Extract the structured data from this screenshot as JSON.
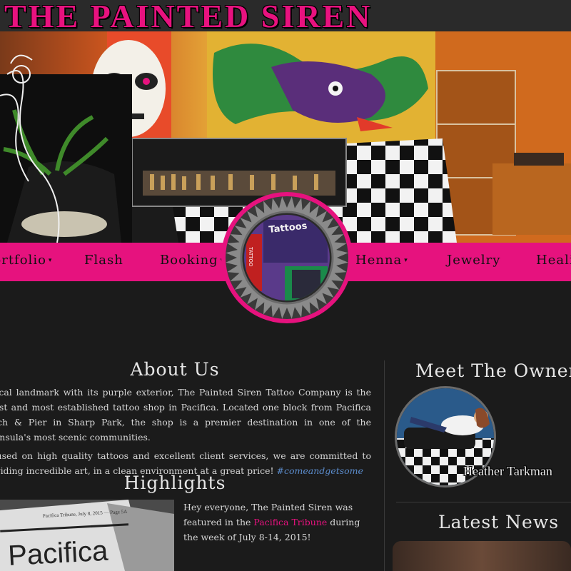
{
  "site": {
    "title": "The Painted Siren"
  },
  "nav": {
    "items": [
      {
        "label": "Portfolio",
        "has_dropdown": true
      },
      {
        "label": "Flash",
        "has_dropdown": false
      },
      {
        "label": "Booking",
        "has_dropdown": true
      },
      {
        "label": "Henna",
        "has_dropdown": true
      },
      {
        "label": "Jewelry",
        "has_dropdown": false
      },
      {
        "label": "Healing",
        "has_dropdown": false
      }
    ],
    "caret": "▾"
  },
  "logo": {
    "sign_text_1": "Tattoos",
    "sign_text_2": "TATTOO"
  },
  "about": {
    "heading": "About Us",
    "paragraph_1": "A local landmark with its purple exterior, The Painted Siren Tattoo Company is the oldest and most established tattoo shop in Pacifica. Located one block from Pacifica Beach & Pier in Sharp Park, the shop is a premier destination in one of the Peninsula's most scenic communities.",
    "paragraph_2": "Focused on high quality tattoos and excellent client services, we are committed to providing incredible art, in a clean environment at a great price!",
    "hashtag": "#comeandgetsome"
  },
  "highlights": {
    "heading": "Highlights",
    "text_before": "Hey everyone, The Painted Siren was featured in the",
    "link": "Pacifica Tribune",
    "text_after": "during the week of July 8-14, 2015!",
    "newspaper_masthead": "Pacifica",
    "newspaper_line": "Pacifica Tribune, July 8, 2015 — Page 5A"
  },
  "owner": {
    "heading": "Meet The Owner",
    "name": "Heather Tarkman"
  },
  "news": {
    "heading": "Latest News"
  },
  "colors": {
    "accent_pink": "#e6127e",
    "background": "#1b1b1b",
    "link_blue": "#5b8ccc"
  }
}
